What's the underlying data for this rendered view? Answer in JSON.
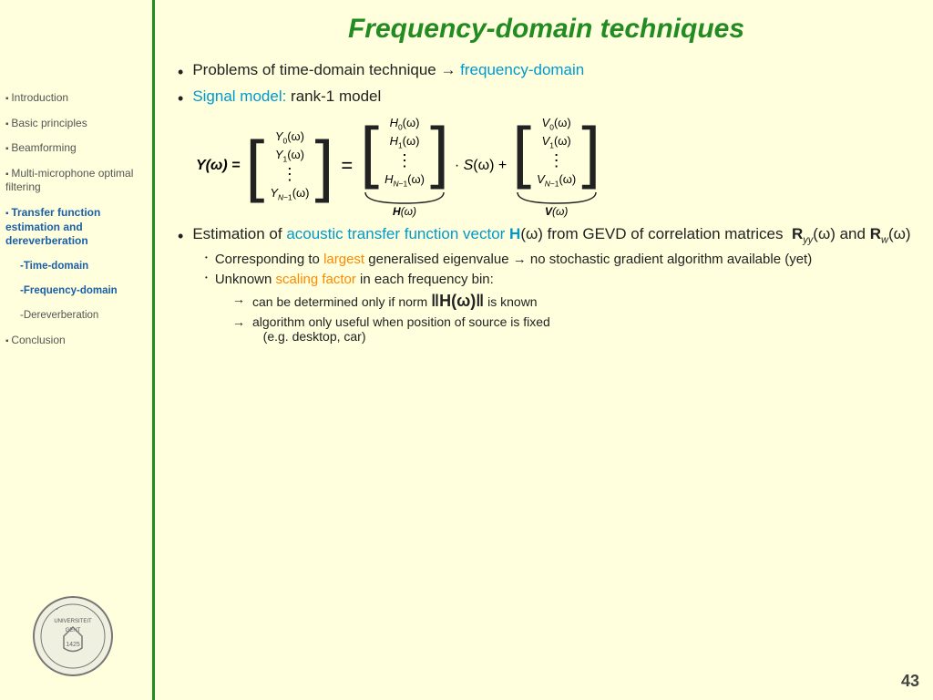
{
  "title": "Frequency-domain techniques",
  "page_number": "43",
  "sidebar": {
    "items": [
      {
        "label": "Introduction",
        "active": false,
        "class": "normal"
      },
      {
        "label": "Basic principles",
        "active": false,
        "class": "normal"
      },
      {
        "label": "Beamforming",
        "active": false,
        "class": "normal"
      },
      {
        "label": "Multi-microphone optimal filtering",
        "active": false,
        "class": "normal"
      },
      {
        "label": "Transfer function estimation and dereverberation",
        "active": true,
        "class": "active"
      },
      {
        "label": "-Time-domain",
        "active": true,
        "class": "active sub"
      },
      {
        "label": "-Frequency-domain",
        "active": true,
        "class": "active sub"
      },
      {
        "label": "-Dereverberation",
        "active": false,
        "class": "sub"
      },
      {
        "label": "Conclusion",
        "active": false,
        "class": "normal"
      }
    ]
  },
  "content": {
    "bullet1": {
      "prefix": "Problems of time-domain technique → ",
      "highlight": "frequency-domain"
    },
    "bullet2": {
      "highlight": "Signal model:",
      "suffix": " rank-1 model"
    },
    "bullet3": {
      "prefix": "Estimation of ",
      "highlight1": "acoustic transfer function vector ",
      "bold_h": "H",
      "suffix1": "(ω) from",
      "line2": "GEVD of correlation matrices  R",
      "sub_yy": "yy",
      "suffix2": "(ω) and R",
      "sub_w": "w",
      "suffix3": "(ω)"
    },
    "sub_bullet1": {
      "prefix": "Corresponding to ",
      "highlight": "largest",
      "suffix": " generalised eigenvalue → no stochastic gradient algorithm available (yet)"
    },
    "sub_bullet2": {
      "prefix": "Unknown ",
      "highlight": "scaling factor",
      "suffix": " in each frequency bin:"
    },
    "arrow1": {
      "arrow": "→",
      "text": "can be determined only if norm ‖H(ω)‖ is known"
    },
    "arrow2": {
      "arrow": "→",
      "text": "algorithm only useful when position of source is fixed (e.g. desktop, car)"
    }
  },
  "colors": {
    "green": "#228B22",
    "cyan": "#0099cc",
    "blue": "#1a5fa8",
    "orange": "#ff8800",
    "sidebar_active": "#1a5fa8",
    "background": "#ffffdd"
  }
}
